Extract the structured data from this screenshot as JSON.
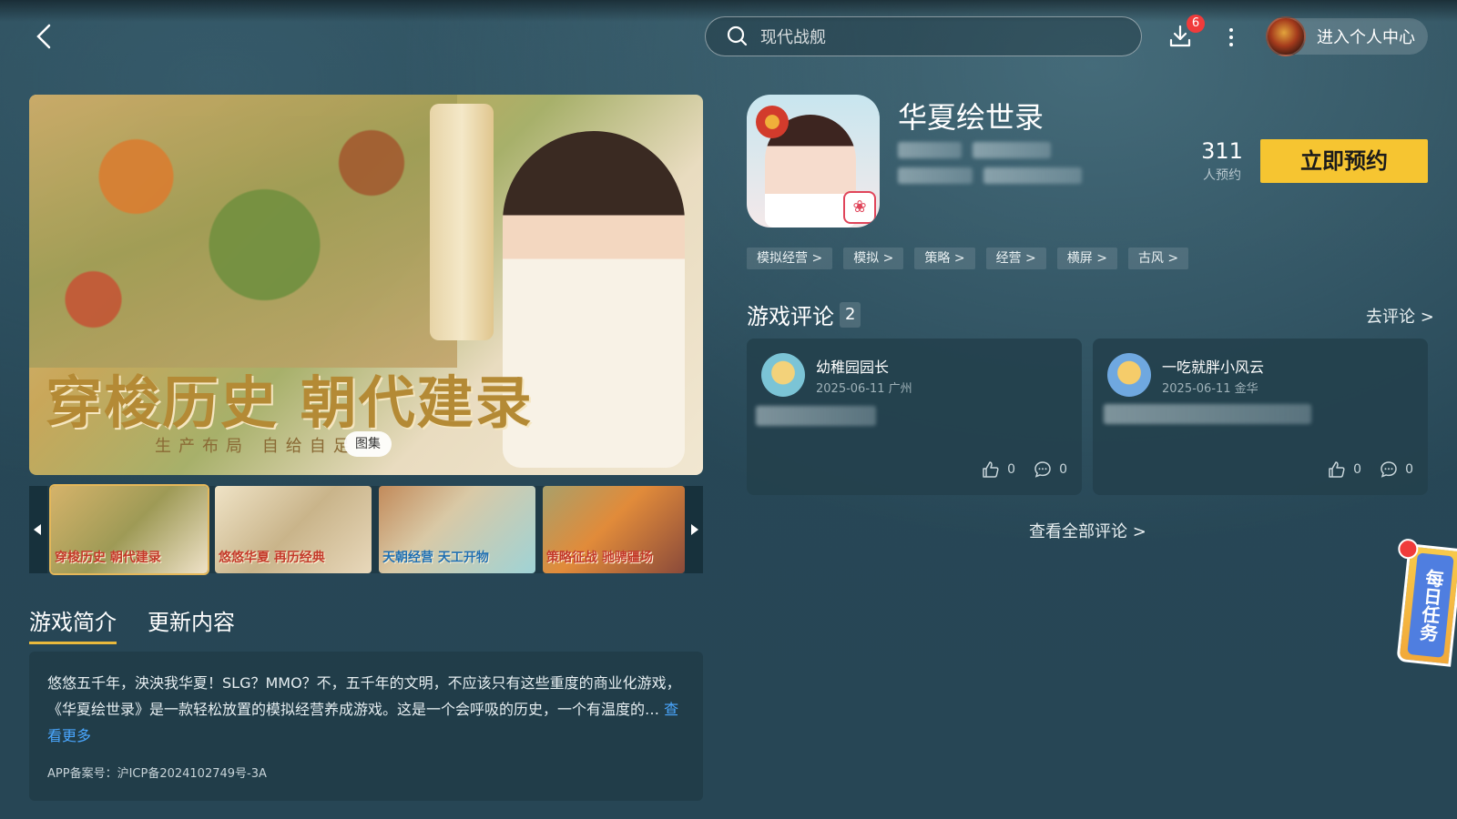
{
  "header": {
    "search_placeholder": "现代战舰",
    "download_badge": "6",
    "profile_label": "进入个人中心"
  },
  "gallery": {
    "slogan": "穿梭历史 朝代建录",
    "subslogan": "生产布局 自给自足",
    "gallery_label": "图集",
    "thumbnails": [
      "穿梭历史 朝代建录",
      "悠悠华夏 再历经典",
      "天朝经营 天工开物",
      "策略征战 驰骋疆场"
    ]
  },
  "tabs": [
    "游戏简介",
    "更新内容"
  ],
  "description": {
    "text": "悠悠五千年，泱泱我华夏！SLG？MMO？不，五千年的文明，不应该只有这些重度的商业化游戏，《华夏绘世录》是一款轻松放置的模拟经营养成游戏。这是一个会呼吸的历史，一个有温度的…",
    "more_label": "查看更多",
    "icp": "APP备案号：沪ICP备2024102749号-3A"
  },
  "game": {
    "title": "华夏绘世录",
    "reservation_count": "311",
    "reservation_label": "人预约",
    "reserve_button": "立即预约",
    "tags": [
      "模拟经营 >",
      "模拟 >",
      "策略 >",
      "经营 >",
      "横屏 >",
      "古风 >"
    ]
  },
  "reviews": {
    "title": "游戏评论",
    "count": "2",
    "go_review": "去评论 >",
    "view_all": "查看全部评论 >",
    "items": [
      {
        "name": "幼稚园园长",
        "meta": "2025-06-11 广州",
        "likes": "0",
        "comments": "0"
      },
      {
        "name": "一吃就胖小风云",
        "meta": "2025-06-11 金华",
        "likes": "0",
        "comments": "0"
      }
    ]
  },
  "daily_task": "每日任务",
  "colors": {
    "accent": "#f6c531",
    "badge": "#f03b3b",
    "link": "#4aa7ff"
  }
}
